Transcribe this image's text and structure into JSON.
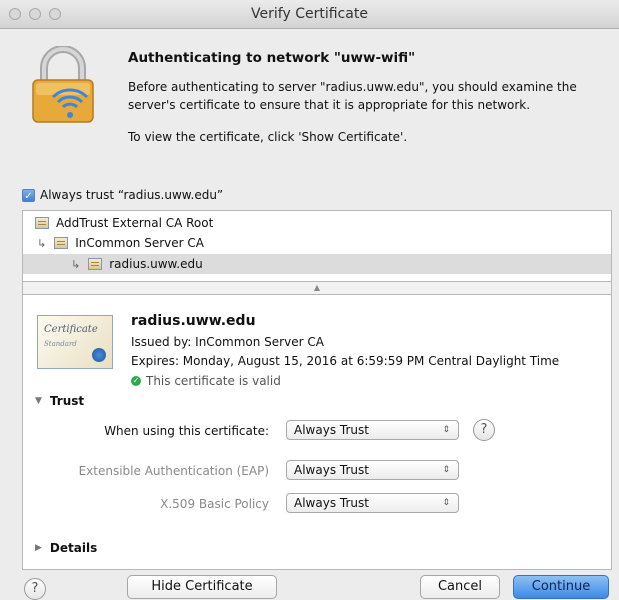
{
  "window": {
    "title": "Verify Certificate"
  },
  "header": {
    "heading": "Authenticating to network \"uww-wifi\"",
    "description": "Before authenticating to server \"radius.uww.edu\", you should examine the server's certificate to ensure that it is appropriate for this network.",
    "show_hint": "To view the certificate, click 'Show Certificate'."
  },
  "always_trust": {
    "label": "Always trust “radius.uww.edu”",
    "checked": true
  },
  "chain": [
    {
      "label": "AddTrust External CA Root",
      "arrow": "",
      "selected": false
    },
    {
      "label": "InCommon Server CA",
      "arrow": "↳",
      "selected": false
    },
    {
      "label": "radius.uww.edu",
      "arrow": "↳",
      "selected": true
    }
  ],
  "certificate": {
    "icon_script": "Certificate",
    "icon_sub": "Standard",
    "common_name": "radius.uww.edu",
    "issued_by": "Issued by: InCommon Server CA",
    "expires": "Expires: Monday, August 15, 2016 at 6:59:59 PM Central Daylight Time",
    "status": "This certificate is valid",
    "status_color": "#2fa84b"
  },
  "trust": {
    "section_label": "Trust",
    "settings": [
      {
        "label": "When using this certificate:",
        "value": "Always Trust",
        "dim": false
      },
      {
        "label": "Extensible Authentication (EAP)",
        "value": "Always Trust",
        "dim": true
      },
      {
        "label": "X.509 Basic Policy",
        "value": "Always Trust",
        "dim": true
      }
    ]
  },
  "details": {
    "section_label": "Details"
  },
  "buttons": {
    "help": "?",
    "hide_certificate": "Hide Certificate",
    "cancel": "Cancel",
    "continue": "Continue"
  },
  "colors": {
    "accent": "#3d8ae6",
    "lock_gold": "#e7a93a",
    "wifi_blue": "#3f86d8"
  },
  "icons": [
    "lock-wifi-icon",
    "checkbox-icon",
    "certificate-icon",
    "valid-check-icon",
    "disclosure-icon",
    "popup-arrows-icon",
    "help-icon"
  ]
}
